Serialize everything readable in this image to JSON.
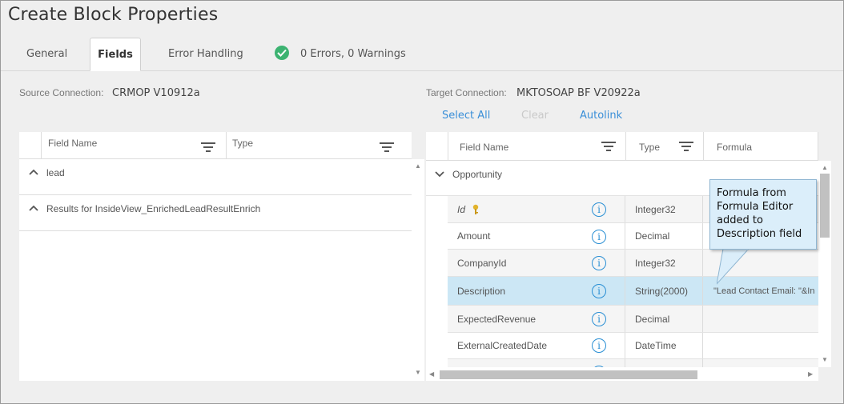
{
  "window": {
    "title": "Create Block Properties"
  },
  "tabs": [
    {
      "label": "General"
    },
    {
      "label": "Fields"
    },
    {
      "label": "Error Handling"
    }
  ],
  "status": {
    "text": "0 Errors, 0 Warnings",
    "color": "#3cb371"
  },
  "source": {
    "label": "Source Connection:",
    "value": "CRMOP V10912a",
    "columns": [
      "Field Name",
      "Type"
    ],
    "groups": [
      {
        "label": "lead"
      },
      {
        "label": "Results for InsideView_EnrichedLeadResultEnrich"
      }
    ]
  },
  "target": {
    "label": "Target Connection:",
    "value": "MKTOSOAP BF V20922a",
    "actions": {
      "select_all": "Select All",
      "clear": "Clear",
      "autolink": "Autolink"
    },
    "columns": [
      "Field Name",
      "Type",
      "Formula"
    ],
    "group": "Opportunity",
    "rows": [
      {
        "name": "Id",
        "type": "Integer32",
        "formula": "",
        "key": true
      },
      {
        "name": "Amount",
        "type": "Decimal",
        "formula": ""
      },
      {
        "name": "CompanyId",
        "type": "Integer32",
        "formula": ""
      },
      {
        "name": "Description",
        "type": "String(2000)",
        "formula": "\"Lead Contact Email: \"&In",
        "selected": true
      },
      {
        "name": "ExpectedRevenue",
        "type": "Decimal",
        "formula": ""
      },
      {
        "name": "ExternalCreatedDate",
        "type": "DateTime",
        "formula": ""
      }
    ]
  },
  "callout": {
    "text": "Formula from Formula Editor added to Description field"
  },
  "icons": {
    "status": "check-circle-icon",
    "filter": "filter-icon",
    "info": "info-icon",
    "key": "key-icon",
    "collapse": "chevron-up-icon"
  },
  "colors": {
    "accent": "#3a8fd8",
    "selected_row": "#cce7f5",
    "callout_bg": "#dbeefa"
  }
}
